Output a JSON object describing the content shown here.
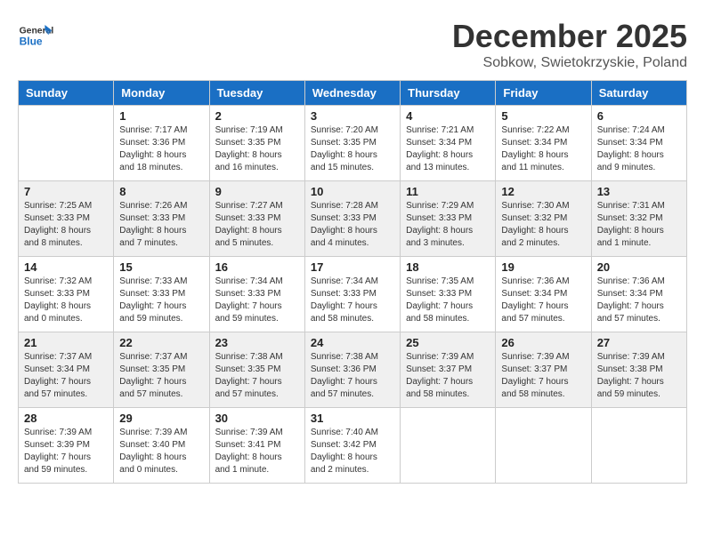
{
  "logo": {
    "general": "General",
    "blue": "Blue"
  },
  "title": "December 2025",
  "subtitle": "Sobkow, Swietokrzyskie, Poland",
  "days_of_week": [
    "Sunday",
    "Monday",
    "Tuesday",
    "Wednesday",
    "Thursday",
    "Friday",
    "Saturday"
  ],
  "weeks": [
    [
      {
        "day": "",
        "info": ""
      },
      {
        "day": "1",
        "info": "Sunrise: 7:17 AM\nSunset: 3:36 PM\nDaylight: 8 hours\nand 18 minutes."
      },
      {
        "day": "2",
        "info": "Sunrise: 7:19 AM\nSunset: 3:35 PM\nDaylight: 8 hours\nand 16 minutes."
      },
      {
        "day": "3",
        "info": "Sunrise: 7:20 AM\nSunset: 3:35 PM\nDaylight: 8 hours\nand 15 minutes."
      },
      {
        "day": "4",
        "info": "Sunrise: 7:21 AM\nSunset: 3:34 PM\nDaylight: 8 hours\nand 13 minutes."
      },
      {
        "day": "5",
        "info": "Sunrise: 7:22 AM\nSunset: 3:34 PM\nDaylight: 8 hours\nand 11 minutes."
      },
      {
        "day": "6",
        "info": "Sunrise: 7:24 AM\nSunset: 3:34 PM\nDaylight: 8 hours\nand 9 minutes."
      }
    ],
    [
      {
        "day": "7",
        "info": "Sunrise: 7:25 AM\nSunset: 3:33 PM\nDaylight: 8 hours\nand 8 minutes."
      },
      {
        "day": "8",
        "info": "Sunrise: 7:26 AM\nSunset: 3:33 PM\nDaylight: 8 hours\nand 7 minutes."
      },
      {
        "day": "9",
        "info": "Sunrise: 7:27 AM\nSunset: 3:33 PM\nDaylight: 8 hours\nand 5 minutes."
      },
      {
        "day": "10",
        "info": "Sunrise: 7:28 AM\nSunset: 3:33 PM\nDaylight: 8 hours\nand 4 minutes."
      },
      {
        "day": "11",
        "info": "Sunrise: 7:29 AM\nSunset: 3:33 PM\nDaylight: 8 hours\nand 3 minutes."
      },
      {
        "day": "12",
        "info": "Sunrise: 7:30 AM\nSunset: 3:32 PM\nDaylight: 8 hours\nand 2 minutes."
      },
      {
        "day": "13",
        "info": "Sunrise: 7:31 AM\nSunset: 3:32 PM\nDaylight: 8 hours\nand 1 minute."
      }
    ],
    [
      {
        "day": "14",
        "info": "Sunrise: 7:32 AM\nSunset: 3:33 PM\nDaylight: 8 hours\nand 0 minutes."
      },
      {
        "day": "15",
        "info": "Sunrise: 7:33 AM\nSunset: 3:33 PM\nDaylight: 7 hours\nand 59 minutes."
      },
      {
        "day": "16",
        "info": "Sunrise: 7:34 AM\nSunset: 3:33 PM\nDaylight: 7 hours\nand 59 minutes."
      },
      {
        "day": "17",
        "info": "Sunrise: 7:34 AM\nSunset: 3:33 PM\nDaylight: 7 hours\nand 58 minutes."
      },
      {
        "day": "18",
        "info": "Sunrise: 7:35 AM\nSunset: 3:33 PM\nDaylight: 7 hours\nand 58 minutes."
      },
      {
        "day": "19",
        "info": "Sunrise: 7:36 AM\nSunset: 3:34 PM\nDaylight: 7 hours\nand 57 minutes."
      },
      {
        "day": "20",
        "info": "Sunrise: 7:36 AM\nSunset: 3:34 PM\nDaylight: 7 hours\nand 57 minutes."
      }
    ],
    [
      {
        "day": "21",
        "info": "Sunrise: 7:37 AM\nSunset: 3:34 PM\nDaylight: 7 hours\nand 57 minutes."
      },
      {
        "day": "22",
        "info": "Sunrise: 7:37 AM\nSunset: 3:35 PM\nDaylight: 7 hours\nand 57 minutes."
      },
      {
        "day": "23",
        "info": "Sunrise: 7:38 AM\nSunset: 3:35 PM\nDaylight: 7 hours\nand 57 minutes."
      },
      {
        "day": "24",
        "info": "Sunrise: 7:38 AM\nSunset: 3:36 PM\nDaylight: 7 hours\nand 57 minutes."
      },
      {
        "day": "25",
        "info": "Sunrise: 7:39 AM\nSunset: 3:37 PM\nDaylight: 7 hours\nand 58 minutes."
      },
      {
        "day": "26",
        "info": "Sunrise: 7:39 AM\nSunset: 3:37 PM\nDaylight: 7 hours\nand 58 minutes."
      },
      {
        "day": "27",
        "info": "Sunrise: 7:39 AM\nSunset: 3:38 PM\nDaylight: 7 hours\nand 59 minutes."
      }
    ],
    [
      {
        "day": "28",
        "info": "Sunrise: 7:39 AM\nSunset: 3:39 PM\nDaylight: 7 hours\nand 59 minutes."
      },
      {
        "day": "29",
        "info": "Sunrise: 7:39 AM\nSunset: 3:40 PM\nDaylight: 8 hours\nand 0 minutes."
      },
      {
        "day": "30",
        "info": "Sunrise: 7:39 AM\nSunset: 3:41 PM\nDaylight: 8 hours\nand 1 minute."
      },
      {
        "day": "31",
        "info": "Sunrise: 7:40 AM\nSunset: 3:42 PM\nDaylight: 8 hours\nand 2 minutes."
      },
      {
        "day": "",
        "info": ""
      },
      {
        "day": "",
        "info": ""
      },
      {
        "day": "",
        "info": ""
      }
    ]
  ]
}
